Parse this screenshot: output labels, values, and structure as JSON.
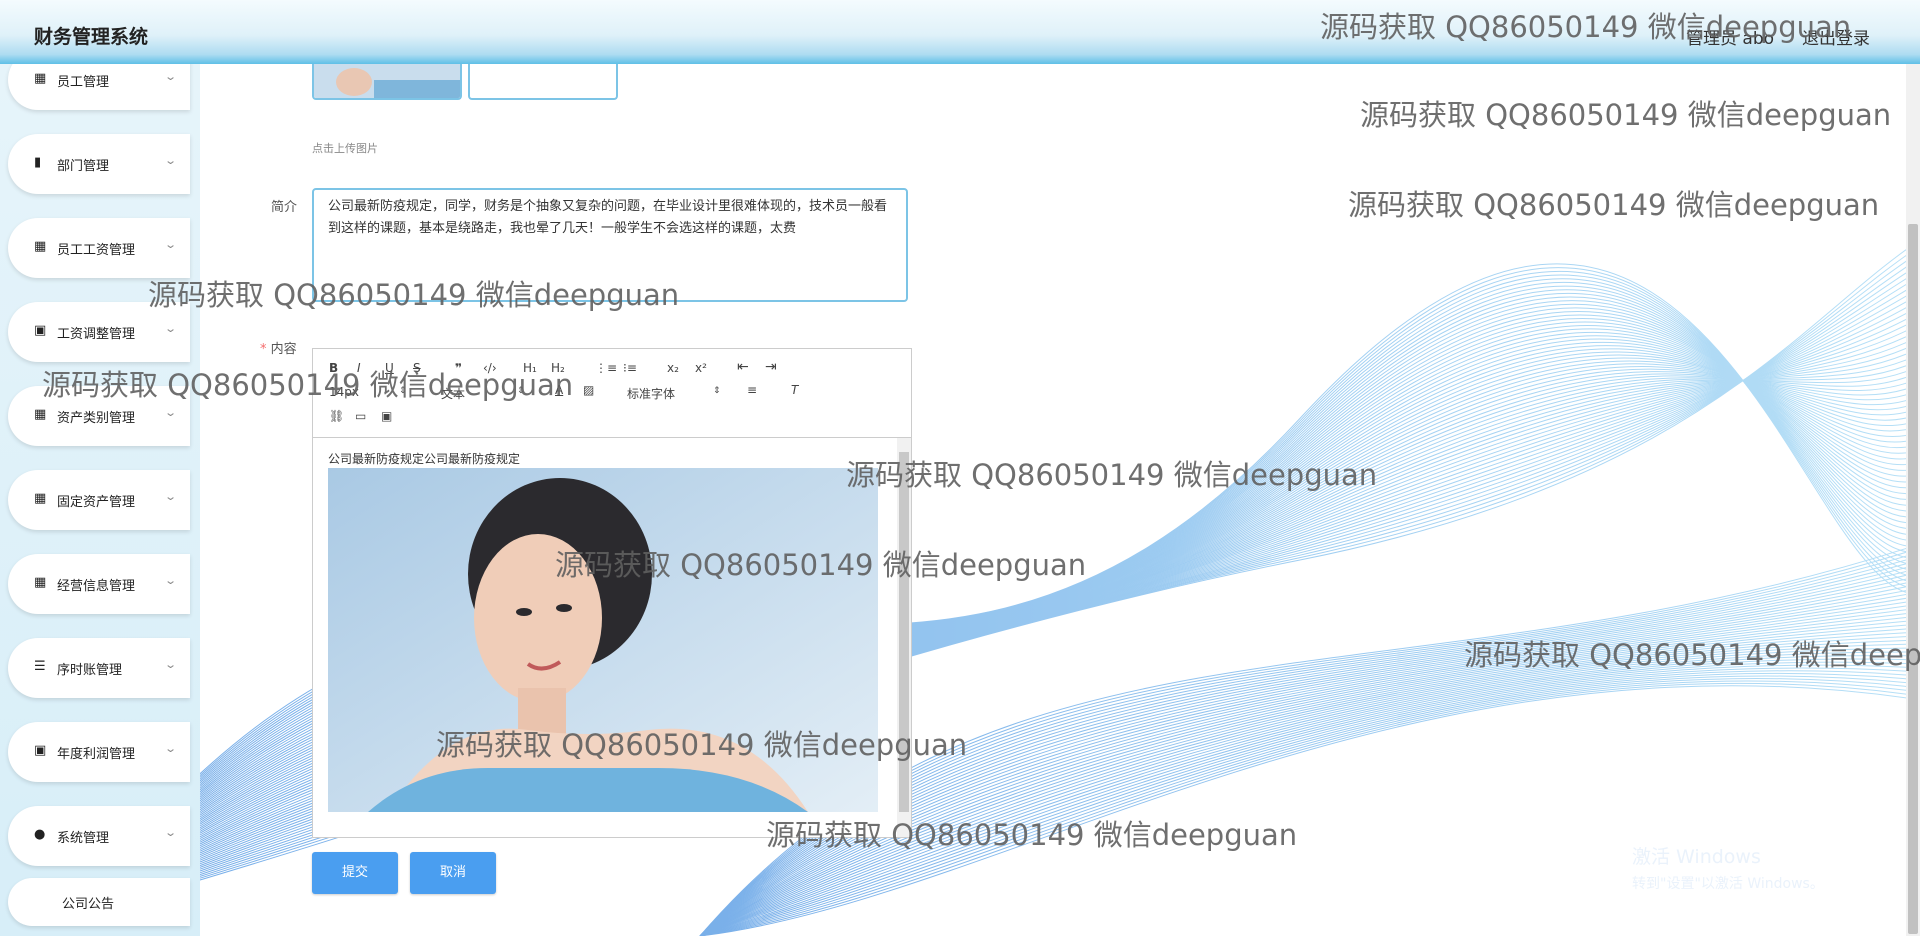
{
  "app": {
    "title": "财务管理系统"
  },
  "header": {
    "user_info": "管理员 abo",
    "logout_label": "退出登录"
  },
  "sidebar": {
    "items": [
      {
        "label": "员工管理",
        "icon": "grid-icon"
      },
      {
        "label": "部门管理",
        "icon": "bar-chart-icon"
      },
      {
        "label": "员工工资管理",
        "icon": "grid-icon"
      },
      {
        "label": "工资调整管理",
        "icon": "clipboard-icon"
      },
      {
        "label": "资产类别管理",
        "icon": "grid-icon"
      },
      {
        "label": "固定资产管理",
        "icon": "grid-icon"
      },
      {
        "label": "经营信息管理",
        "icon": "grid-icon"
      },
      {
        "label": "序时账管理",
        "icon": "list-icon"
      },
      {
        "label": "年度利润管理",
        "icon": "clipboard-check-icon"
      },
      {
        "label": "系统管理",
        "icon": "user-icon"
      }
    ],
    "notice": "公司公告"
  },
  "form": {
    "upload_tip": "点击上传图片",
    "summary_label": "简介",
    "summary_value": "公司最新防疫规定，同学，财务是个抽象又复杂的问题，在毕业设计里很难体现的，技术员一般看到这样的课题，基本是绕路走，我也晕了几天！一般学生不会选这样的课题，太费",
    "content_required": "*",
    "content_label": "内容",
    "submit_label": "提交",
    "cancel_label": "取消"
  },
  "editor": {
    "toolbar": {
      "bold": "B",
      "italic": "I",
      "underline": "U",
      "strike": "S",
      "quote": "❞",
      "code": "‹/›",
      "h1": "H₁",
      "h2": "H₂",
      "ordered_list": "⋮≡",
      "bullet_list": "⁝≡",
      "subscript": "x₂",
      "superscript": "x²",
      "outdent": "⇤",
      "indent": "⇥",
      "size": "14px",
      "header": "文本",
      "font": "标准字体"
    },
    "body_text": "公司最新防疫规定公司最新防疫规定"
  },
  "watermark": {
    "text": "源码获取 QQ86050149 微信deepguan"
  },
  "windows": {
    "activate_title": "激活 Windows",
    "activate_sub": "转到\"设置\"以激活 Windows。"
  },
  "colors": {
    "accent": "#4a9ef0",
    "border": "#7cc4e6",
    "wave": "#1a8fe0"
  }
}
